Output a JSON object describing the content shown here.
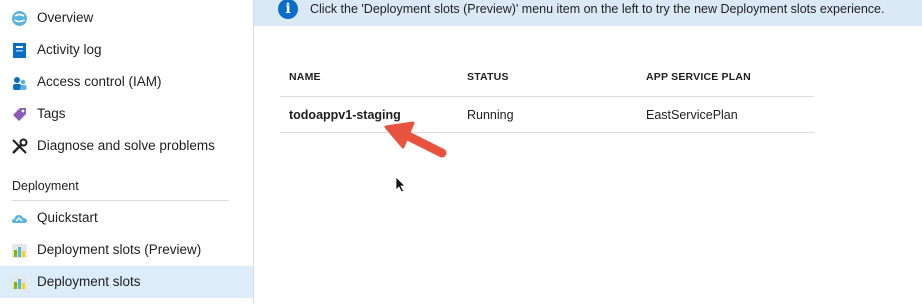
{
  "sidebar": {
    "items": [
      {
        "label": "Overview",
        "icon": "overview-icon"
      },
      {
        "label": "Activity log",
        "icon": "activity-log-icon"
      },
      {
        "label": "Access control (IAM)",
        "icon": "access-control-icon"
      },
      {
        "label": "Tags",
        "icon": "tag-icon"
      },
      {
        "label": "Diagnose and solve problems",
        "icon": "wrench-icon"
      }
    ],
    "section_header": "Deployment",
    "deployment_items": [
      {
        "label": "Quickstart",
        "icon": "cloud-quickstart-icon"
      },
      {
        "label": "Deployment slots (Preview)",
        "icon": "deployment-slots-icon"
      },
      {
        "label": "Deployment slots",
        "icon": "deployment-slots-icon",
        "selected": true
      }
    ]
  },
  "banner": {
    "icon": "info-icon",
    "message": "Click the 'Deployment slots (Preview)' menu item on the left to try the new Deployment slots experience."
  },
  "slots_table": {
    "columns": [
      "NAME",
      "STATUS",
      "APP SERVICE PLAN"
    ],
    "rows": [
      {
        "name": "todoappv1-staging",
        "status": "Running",
        "plan": "EastServicePlan"
      }
    ]
  },
  "colors": {
    "accent": "#0b6dc6",
    "selected_bg": "#dcecf9",
    "banner_bg": "#dbe9f7",
    "annotation_arrow": "#e8533f"
  }
}
